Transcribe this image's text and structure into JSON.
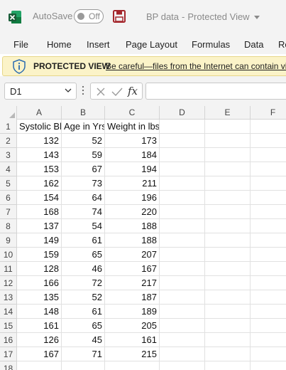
{
  "window": {
    "autosave_label": "AutoSave",
    "autosave_state": "Off",
    "doc_name": "BP data",
    "separator": "-",
    "doc_mode": "Protected View"
  },
  "menu": [
    "File",
    "Home",
    "Insert",
    "Page Layout",
    "Formulas",
    "Data",
    "Re"
  ],
  "protected_view": {
    "title": "PROTECTED VIEW",
    "message": "Be careful—files from the Internet can contain vi"
  },
  "formula_bar": {
    "name_box": "D1",
    "fx_label": "fx",
    "formula": ""
  },
  "sheet": {
    "columns": [
      "A",
      "B",
      "C",
      "D",
      "E",
      "F"
    ],
    "row_numbers": [
      "1",
      "2",
      "3",
      "4",
      "5",
      "6",
      "7",
      "8",
      "9",
      "10",
      "11",
      "12",
      "13",
      "14",
      "15",
      "16",
      "17",
      "18"
    ],
    "headers": [
      "Systolic Bl",
      "Age in Yrs",
      "Weight in lbs."
    ],
    "rows": [
      [
        "132",
        "52",
        "173"
      ],
      [
        "143",
        "59",
        "184"
      ],
      [
        "153",
        "67",
        "194"
      ],
      [
        "162",
        "73",
        "211"
      ],
      [
        "154",
        "64",
        "196"
      ],
      [
        "168",
        "74",
        "220"
      ],
      [
        "137",
        "54",
        "188"
      ],
      [
        "149",
        "61",
        "188"
      ],
      [
        "159",
        "65",
        "207"
      ],
      [
        "128",
        "46",
        "167"
      ],
      [
        "166",
        "72",
        "217"
      ],
      [
        "135",
        "52",
        "187"
      ],
      [
        "148",
        "61",
        "189"
      ],
      [
        "161",
        "65",
        "205"
      ],
      [
        "126",
        "45",
        "161"
      ],
      [
        "167",
        "71",
        "215"
      ]
    ]
  },
  "colors": {
    "excel_green": "#107c41",
    "save_purple": "#a4262c",
    "protected_bar": "#fbf3c8",
    "info_blue": "#2b6cb0"
  }
}
